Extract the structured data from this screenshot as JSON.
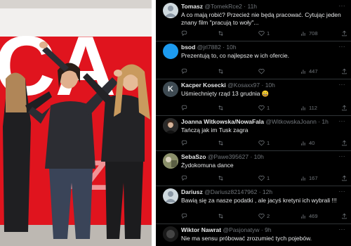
{
  "photo": {
    "banner_letters": "CA",
    "banner_letters_small": "OZ"
  },
  "tweets": [
    {
      "name": "Tomasz",
      "handle": "@TomekRce2",
      "time": "11h",
      "text": "A co mają robić? Przecież nie będą pracować. Cytując jeden znany film \"pracują to woły\"...",
      "replies": "",
      "retweets": "",
      "likes": "1",
      "views": "708",
      "avatar_color": "#cfd9de",
      "avatar_icon": "default-person-icon"
    },
    {
      "name": "bsod",
      "handle": "@jrl7882",
      "time": "10h",
      "text": "Prezentują to, co najlepsze w ich ofercie.",
      "replies": "",
      "retweets": "",
      "likes": "",
      "views": "447",
      "avatar_color": "#1d9bf0",
      "avatar_icon": "blue-circle-avatar"
    },
    {
      "name": "Kacper Kosecki",
      "handle": "@Kosaxx97",
      "time": "10h",
      "text": "Uśmiechnięty rząd 13 grudnia 😄",
      "replies": "",
      "retweets": "",
      "likes": "1",
      "views": "112",
      "avatar_color": "#3e4a52",
      "avatar_letter": "K",
      "avatar_icon": "letter-k-avatar"
    },
    {
      "name": "Joanna Witkowska/NowaFala",
      "handle": "@WitkowskaJoann",
      "time": "1h",
      "text": "Tańczą jak im Tusk zagra",
      "replies": "",
      "retweets": "",
      "likes": "1",
      "views": "40",
      "avatar_color": "#2a2a2a",
      "avatar_icon": "portrait-avatar"
    },
    {
      "name": "SebaSzo",
      "handle": "@Pawe395627",
      "time": "10h",
      "text": "Żydokomuna dance",
      "replies": "",
      "retweets": "",
      "likes": "1",
      "views": "167",
      "avatar_color": "#8a8f6a",
      "avatar_icon": "photo-avatar"
    },
    {
      "name": "Dariusz",
      "handle": "@Dariusz82147962",
      "time": "12h",
      "text": "Bawią się za nasze podatki , ale jacyś kretyni ich wybrali !!!",
      "replies": "",
      "retweets": "",
      "likes": "2",
      "views": "469",
      "avatar_color": "#cfd9de",
      "avatar_icon": "default-person-icon"
    },
    {
      "name": "Wiktor Nawrat",
      "handle": "@Pasjonatyw",
      "time": "9h",
      "text": "Nie ma sensu  próbować zrozumieć tych pojebów.",
      "replies": "",
      "retweets": "",
      "likes": "",
      "views": "",
      "avatar_color": "#1a1a1a",
      "avatar_icon": "dark-avatar"
    }
  ]
}
